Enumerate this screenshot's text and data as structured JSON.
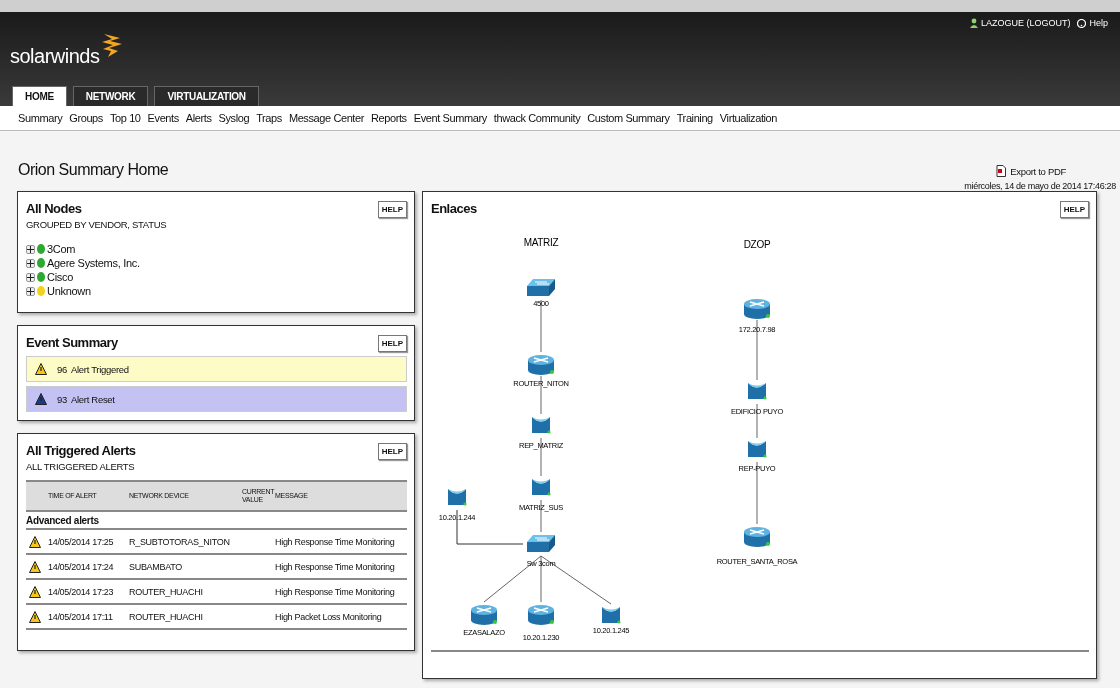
{
  "header": {
    "logo": "solarwinds",
    "user": "LAZOGUE (LOGOUT)",
    "help": "Help"
  },
  "tabs": [
    {
      "label": "HOME",
      "selected": true
    },
    {
      "label": "NETWORK",
      "selected": false
    },
    {
      "label": "VIRTUALIZATION",
      "selected": false
    }
  ],
  "nav": [
    "Summary",
    "Groups",
    "Top 10",
    "Events",
    "Alerts",
    "Syslog",
    "Traps",
    "Message Center",
    "Reports",
    "Event Summary",
    "thwack Community",
    "Custom Summary",
    "Training",
    "Virtualization"
  ],
  "page": {
    "title": "Orion Summary Home",
    "export": "Export to PDF",
    "datetime": "miércoles, 14 de mayo de 2014 17:46:28"
  },
  "all_nodes": {
    "title": "All Nodes",
    "subtitle": "GROUPED BY VENDOR, STATUS",
    "help": "HELP",
    "items": [
      {
        "label": "3Com",
        "color": "#2ea82e",
        "expanded": false
      },
      {
        "label": "Agere Systems, Inc.",
        "color": "#2ea82e",
        "expanded": false
      },
      {
        "label": "Cisco",
        "color": "#2ea82e",
        "expanded": false
      },
      {
        "label": "Unknown",
        "color": "#f2d21c",
        "expanded": false
      }
    ]
  },
  "event_summary": {
    "title": "Event Summary",
    "help": "HELP",
    "rows": [
      {
        "count": "96",
        "label": "Alert Triggered",
        "color": "#fdfbc6"
      },
      {
        "count": "93",
        "label": "Alert Reset",
        "color": "#c4c2f2"
      }
    ]
  },
  "triggered_alerts": {
    "title": "All Triggered Alerts",
    "subtitle": "ALL TRIGGERED ALERTS",
    "help": "HELP",
    "columns": [
      "TIME OF ALERT",
      "NETWORK DEVICE",
      "CURRENT VALUE",
      "MESSAGE"
    ],
    "group": "Advanced alerts",
    "rows": [
      {
        "time": "14/05/2014 17:25",
        "device": "R_SUBTOTORAS_NITON",
        "message": "High Response Time Monitoring"
      },
      {
        "time": "14/05/2014 17:24",
        "device": "SUBAMBATO",
        "message": "High Response Time Monitoring"
      },
      {
        "time": "14/05/2014 17:23",
        "device": "ROUTER_HUACHI",
        "message": "High Response Time Monitoring"
      },
      {
        "time": "14/05/2014 17:11",
        "device": "ROUTER_HUACHI",
        "message": "High Packet Loss Monitoring"
      }
    ]
  },
  "map": {
    "title": "Enlaces",
    "help": "HELP",
    "groups": [
      "MATRIZ",
      "DZOP"
    ],
    "nodes": [
      {
        "label": "4500",
        "kind": "switch"
      },
      {
        "label": "ROUTER_NITON",
        "kind": "router"
      },
      {
        "label": "REP_MATRIZ",
        "kind": "wireless"
      },
      {
        "label": "MATRIZ_SUS",
        "kind": "wireless"
      },
      {
        "label": "Sw 3com",
        "kind": "switch"
      },
      {
        "label": "10.20.1.244",
        "kind": "wireless"
      },
      {
        "label": "EZASALAZO",
        "kind": "router"
      },
      {
        "label": "10.20.1.230",
        "kind": "router"
      },
      {
        "label": "10.20.1.245",
        "kind": "wireless"
      },
      {
        "label": "172.20.7.98",
        "kind": "router"
      },
      {
        "label": "EDIFICIO PUYO",
        "kind": "wireless"
      },
      {
        "label": "REP-PUYO",
        "kind": "wireless"
      },
      {
        "label": "ROUTER_SANTA_ROSA",
        "kind": "router"
      }
    ]
  }
}
